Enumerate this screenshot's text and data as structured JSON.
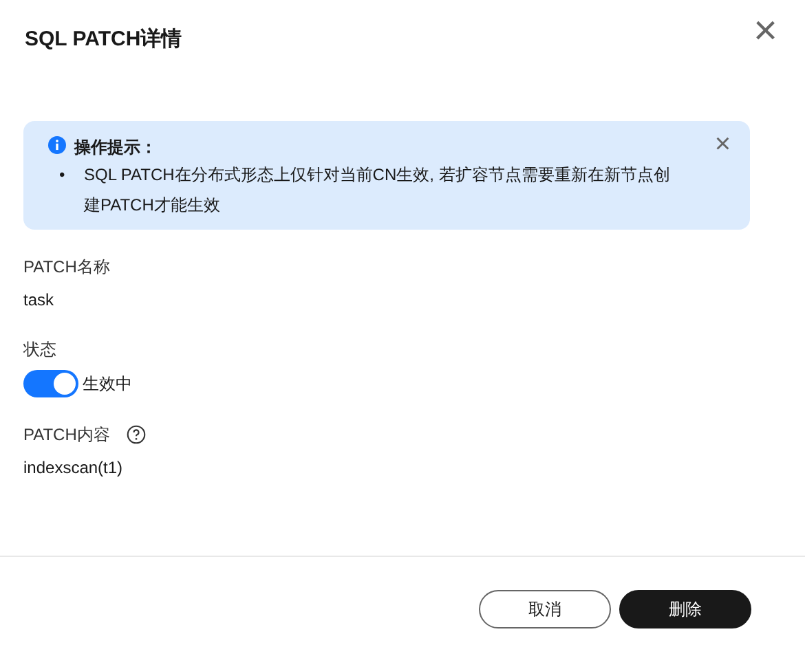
{
  "dialog": {
    "title": "SQL PATCH详情",
    "close": "×"
  },
  "alert": {
    "title": "操作提示：",
    "bullet": "•",
    "items": [
      "SQL PATCH在分布式形态上仅针对当前CN生效, 若扩容节点需要重新在新节点创建PATCH才能生效"
    ]
  },
  "fields": [
    {
      "kind": "text",
      "label": "PATCH名称",
      "value": "task"
    },
    {
      "kind": "switch",
      "label": "状态",
      "on": true,
      "value": "生效中"
    },
    {
      "kind": "help",
      "label": "PATCH内容",
      "value": "indexscan(t1)"
    }
  ],
  "buttons": [
    {
      "label": "取消",
      "primary": false
    },
    {
      "label": "删除",
      "primary": true
    }
  ]
}
